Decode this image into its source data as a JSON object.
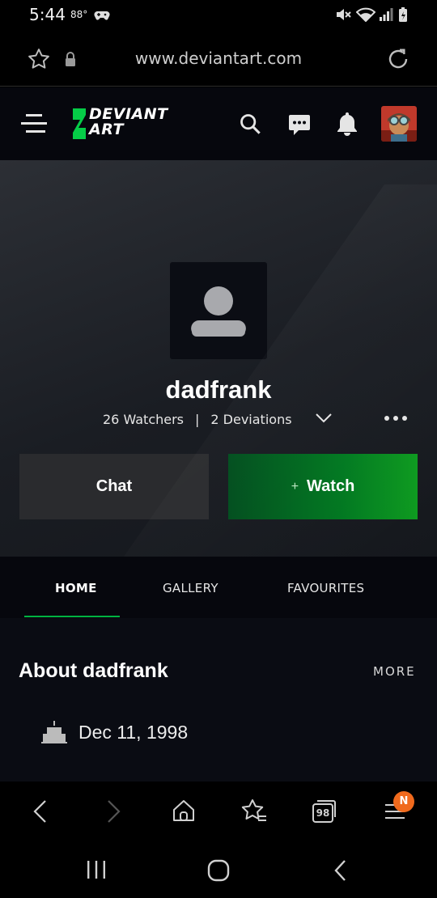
{
  "status_bar": {
    "time": "5:44",
    "temperature": "88°",
    "icons": [
      "controller-icon",
      "mute-icon",
      "wifi-icon",
      "signal-icon",
      "battery-charging-icon"
    ]
  },
  "browser": {
    "url": "www.deviantart.com",
    "icons": [
      "favorite-star-icon",
      "lock-icon",
      "reload-icon"
    ]
  },
  "site_header": {
    "logo_text": "DEVIANT ART",
    "logo_line1": "DEVIANT",
    "logo_line2": "ART",
    "brand_color": "#05cc47",
    "icons": [
      "menu-icon",
      "search-icon",
      "chat-bubble-icon",
      "notification-bell-icon",
      "user-avatar"
    ]
  },
  "profile": {
    "username": "dadfrank",
    "watchers": "26 Watchers",
    "separator": "|",
    "deviations": "2 Deviations",
    "chat_label": "Chat",
    "watch_plus": "+",
    "watch_label": "Watch"
  },
  "tabs": [
    {
      "label": "HOME",
      "active": true
    },
    {
      "label": "GALLERY",
      "active": false
    },
    {
      "label": "FAVOURITES",
      "active": false
    }
  ],
  "about": {
    "title": "About dadfrank",
    "more_label": "MORE",
    "birthday": "Dec 11, 1998"
  },
  "browser_toolbar": {
    "tab_count": "98",
    "menu_badge": "N",
    "badge_color": "#f06a1d",
    "icons": [
      "back-icon",
      "forward-icon",
      "home-icon",
      "bookmarks-icon",
      "tabs-icon",
      "browser-menu-icon"
    ]
  },
  "system_nav": {
    "icons": [
      "recent-apps-icon",
      "home-button-icon",
      "system-back-icon"
    ]
  }
}
